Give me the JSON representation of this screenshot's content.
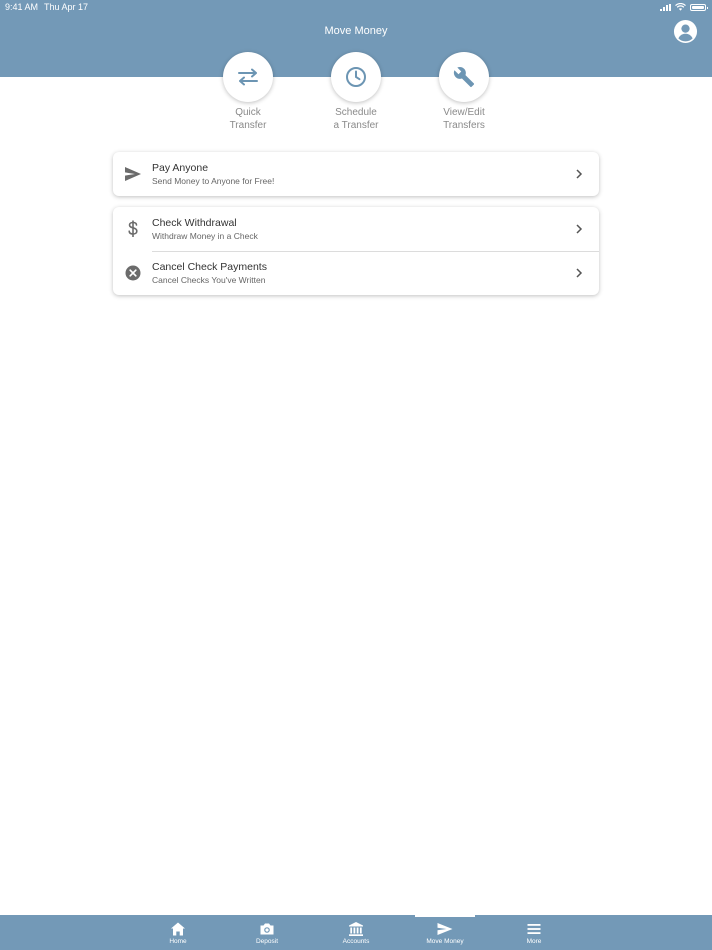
{
  "status_bar": {
    "time": "9:41 AM",
    "date": "Thu Apr 17",
    "battery_level": 1.0
  },
  "header": {
    "title": "Move Money",
    "profile_icon": "person-circle-icon"
  },
  "quick_actions": [
    {
      "line1": "Quick",
      "line2": "Transfer",
      "icon": "swap-arrows-icon"
    },
    {
      "line1": "Schedule",
      "line2": "a Transfer",
      "icon": "clock-icon"
    },
    {
      "line1": "View/Edit",
      "line2": "Transfers",
      "icon": "wrench-icon"
    }
  ],
  "cards": {
    "pay_anyone": {
      "title": "Pay Anyone",
      "subtitle": "Send Money to Anyone for Free!",
      "icon": "send-icon"
    },
    "check_withdrawal": {
      "title": "Check Withdrawal",
      "subtitle": "Withdraw Money in a Check",
      "icon": "dollar-icon"
    },
    "cancel_check": {
      "title": "Cancel Check Payments",
      "subtitle": "Cancel Checks You've Written",
      "icon": "cancel-circle-icon"
    }
  },
  "tab_bar": {
    "items": [
      {
        "label": "Home",
        "icon": "home-icon"
      },
      {
        "label": "Deposit",
        "icon": "camera-icon"
      },
      {
        "label": "Accounts",
        "icon": "bank-icon"
      },
      {
        "label": "Move Money",
        "icon": "send-icon"
      },
      {
        "label": "More",
        "icon": "menu-icon"
      }
    ],
    "active": "Move Money"
  },
  "colors": {
    "brand": "#7399b7",
    "icon_gray": "#6b6b6b",
    "label_gray": "#8a8a8a"
  }
}
